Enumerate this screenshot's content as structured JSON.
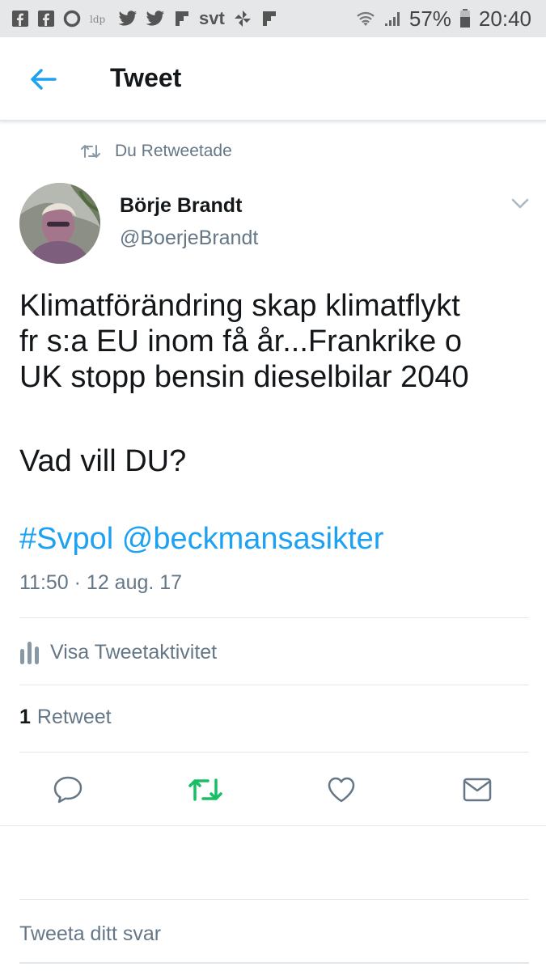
{
  "statusbar": {
    "left_icons": [
      "facebook-icon",
      "facebook-icon",
      "opera-icon",
      "app-icon",
      "twitter-icon",
      "twitter-icon",
      "flipboard-icon"
    ],
    "svt_label": "svt",
    "battery_percent": "57%",
    "time": "20:40"
  },
  "header": {
    "title": "Tweet"
  },
  "retweet_context": {
    "label": "Du Retweetade"
  },
  "author": {
    "name": "Börje Brandt",
    "handle": "@BoerjeBrandt"
  },
  "tweet": {
    "lines": [
      "Klimatförändring skap klimatflykt",
      "fr s:a EU inom få år...Frankrike o",
      "UK stopp bensin dieselbilar 2040"
    ],
    "question": "Vad vill DU?",
    "hashtag": "#Svpol",
    "mention": "@beckmansasikter",
    "timestamp": "11:50 · 12 aug. 17"
  },
  "activity": {
    "label": "Visa Tweetaktivitet"
  },
  "retweets": {
    "count": "1",
    "label": "Retweet"
  },
  "reply": {
    "placeholder": "Tweeta ditt svar"
  },
  "colors": {
    "accent": "#1da1f2",
    "retweet_active": "#17bf63",
    "secondary_text": "#657786"
  }
}
